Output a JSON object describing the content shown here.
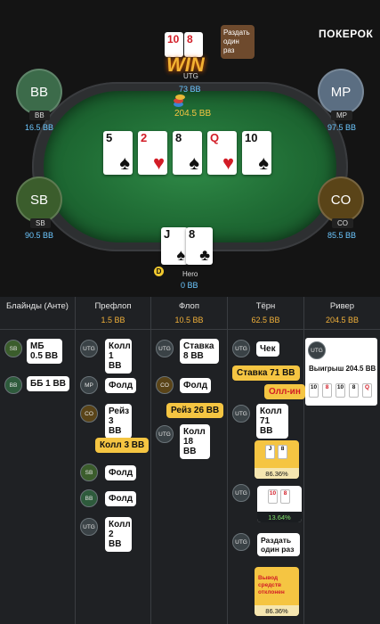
{
  "brand": "ПОКЕРОК",
  "seats": {
    "bb": {
      "badge": "BB",
      "name": "BB",
      "stack": "16.5 BB"
    },
    "sb": {
      "badge": "SB",
      "name": "SB",
      "stack": "90.5 BB"
    },
    "mp": {
      "badge": "MP",
      "name": "MP",
      "stack": "97.5 BB"
    },
    "co": {
      "badge": "CO",
      "name": "CO",
      "stack": "85.5 BB"
    },
    "utg": {
      "name": "UTG",
      "stack": "73 BB",
      "cards": [
        {
          "rank": "10",
          "suit": "♥"
        },
        {
          "rank": "8",
          "suit": "♥"
        }
      ],
      "win_label": "WIN",
      "bubble": "Раздать один раз"
    },
    "hero": {
      "name": "Hero",
      "stack": "0 BB",
      "cards": [
        {
          "rank": "J",
          "suit": "♠"
        },
        {
          "rank": "8",
          "suit": "♣"
        }
      ]
    }
  },
  "pot": "204.5 BB",
  "board": [
    {
      "rank": "5",
      "suit": "♠"
    },
    {
      "rank": "2",
      "suit": "♥"
    },
    {
      "rank": "8",
      "suit": "♠"
    },
    {
      "rank": "Q",
      "suit": "♥"
    },
    {
      "rank": "10",
      "suit": "♠"
    }
  ],
  "colors": {
    "pot_highlight": "#f5c542",
    "stack": "#6cc7ff",
    "win_pct": "#7fe06a"
  },
  "history": {
    "headers": [
      {
        "title": "Блайнды (Анте)",
        "value": ""
      },
      {
        "title": "Префлоп",
        "value": "1.5 BB"
      },
      {
        "title": "Флоп",
        "value": "10.5 BB"
      },
      {
        "title": "Тёрн",
        "value": "62.5 BB"
      },
      {
        "title": "Ривер",
        "value": "204.5 BB"
      }
    ],
    "blinds": [
      {
        "pos": "SB",
        "text": "МБ 0.5 BB"
      },
      {
        "pos": "BB",
        "text": "ББ 1 BB"
      }
    ],
    "preflop": [
      {
        "pos": "UTG",
        "text": "Колл 1 BB"
      },
      {
        "pos": "MP",
        "text": "Фолд"
      },
      {
        "pos": "CO",
        "text": "Рейз 3 BB"
      },
      {
        "pos": "SB",
        "text": "Фолд"
      },
      {
        "pos": "BB",
        "text": "Фолд"
      },
      {
        "pos": "UTG",
        "text": "Колл 2 BB"
      }
    ],
    "preflop_hero": "Колл 3 BB",
    "flop": [
      {
        "pos": "UTG",
        "text": "Ставка 8 BB"
      },
      {
        "pos": "CO",
        "text": "Фолд"
      },
      {
        "pos": "UTG",
        "text": "Колл 18 BB"
      }
    ],
    "flop_hero": "Рейз 26 BB",
    "turn": [
      {
        "pos": "UTG",
        "text": "Чек"
      },
      {
        "pos": "UTG",
        "text": "Колл 71 BB"
      },
      {
        "pos": "UTG",
        "text": ""
      },
      {
        "pos": "UTG",
        "text": "Раздать один раз"
      }
    ],
    "turn_hero_bet": "Ставка 71 BB",
    "turn_hero_allin": "Олл-ин",
    "turn_hero_equity": "86.36%",
    "turn_utg_equity": "13.64%",
    "turn_cashout_label": "Вывод средств отклонен",
    "turn_cashout_equity": "86.36%",
    "river": {
      "pos": "UTG",
      "text": "Выигрыш 204.5 BB",
      "cards": [
        "10",
        "8",
        "10",
        "8",
        "Q"
      ]
    }
  }
}
